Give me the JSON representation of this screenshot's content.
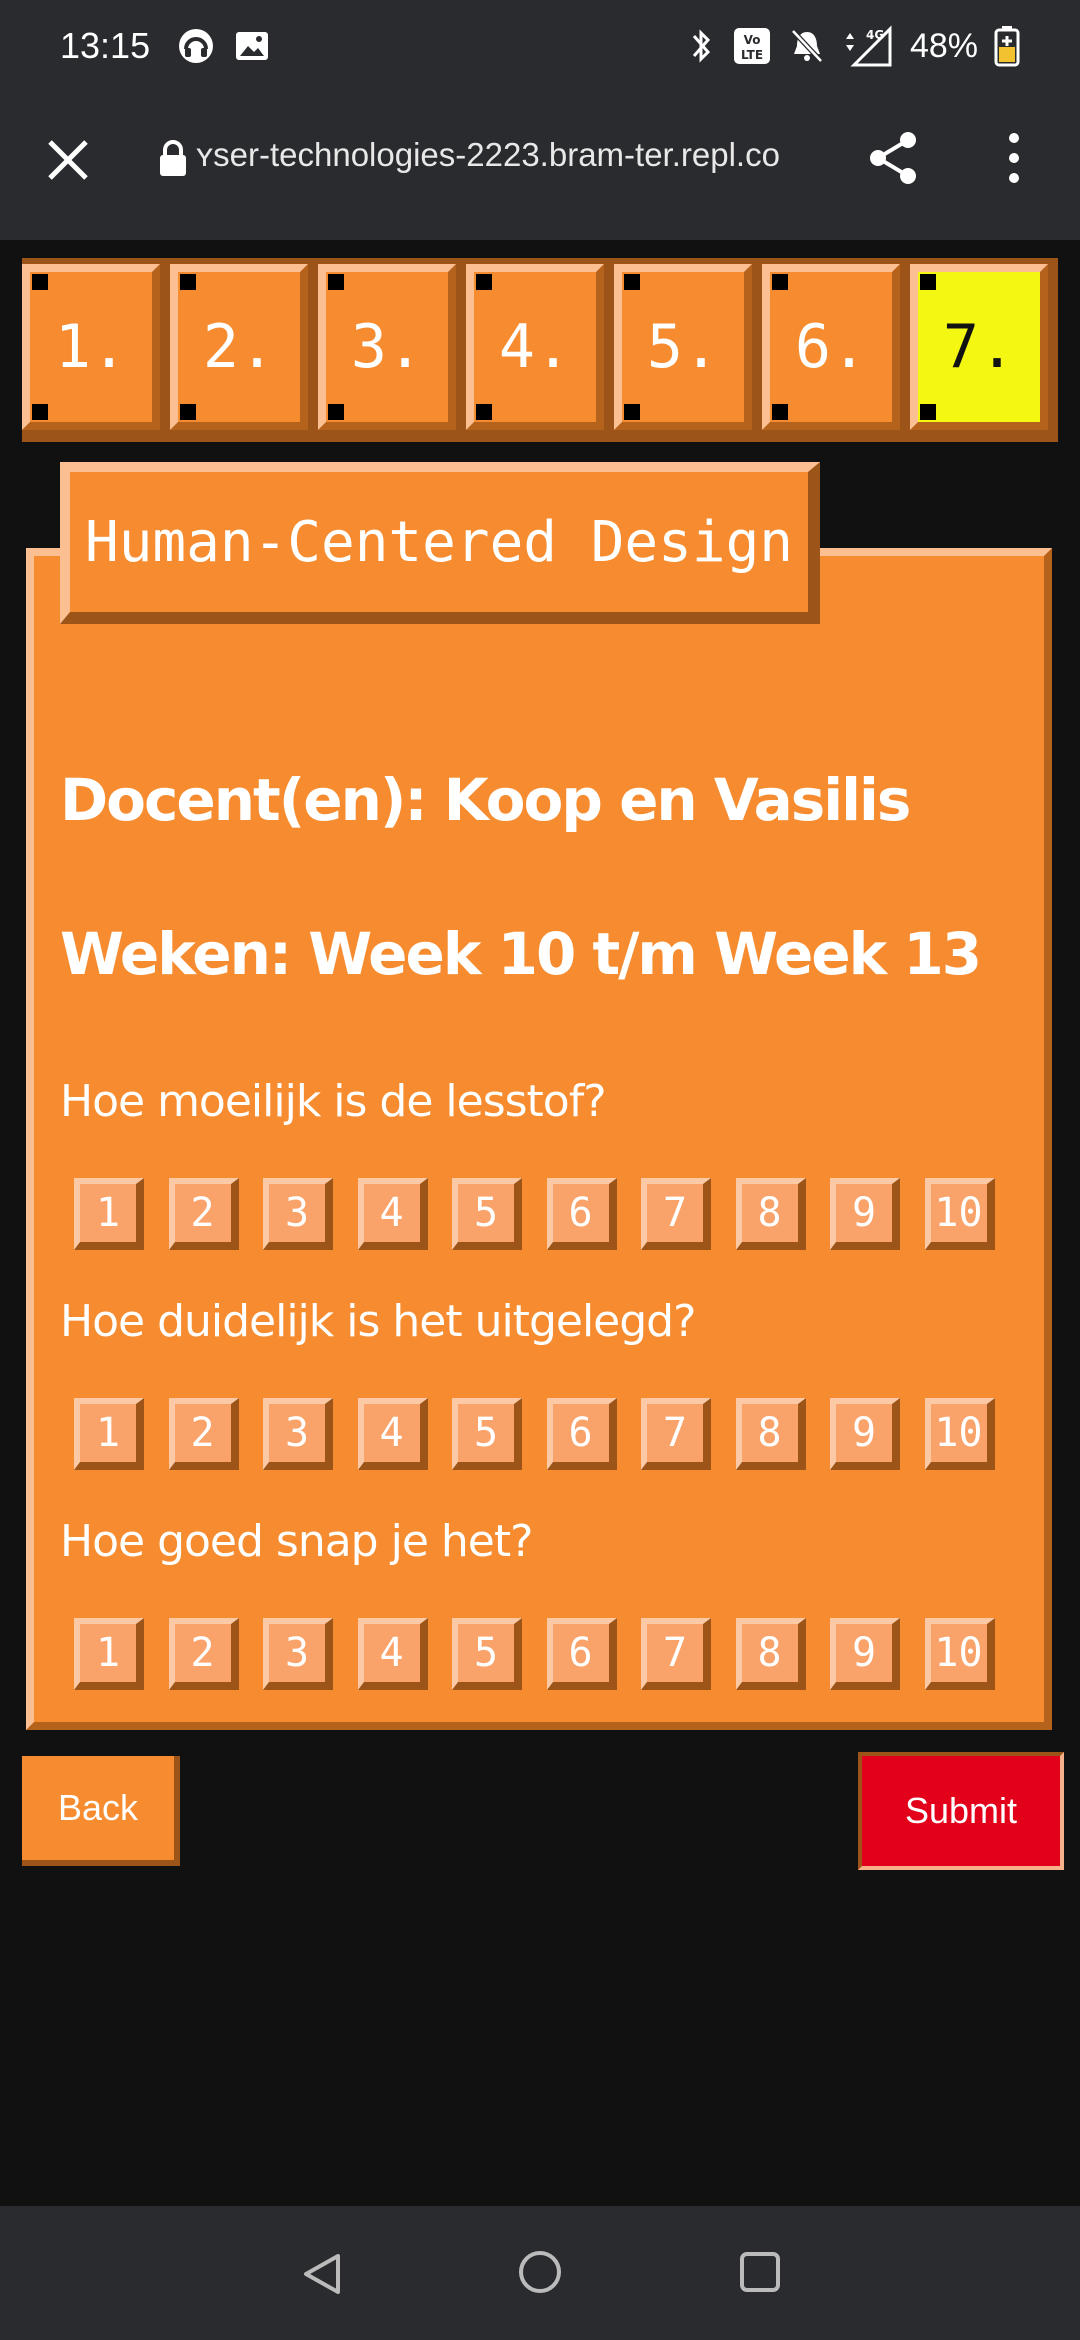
{
  "status_bar": {
    "time": "13:15",
    "battery": "48%",
    "network": "4G",
    "volte": "Vo LTE",
    "icons": [
      "headset-icon",
      "image-icon",
      "bluetooth-icon",
      "volte-icon",
      "mute-icon",
      "signal-icon",
      "battery-icon"
    ]
  },
  "browser": {
    "url": "ʏser-technologies-2223.bram-ter.repl.co"
  },
  "steps": [
    {
      "label": "1."
    },
    {
      "label": "2."
    },
    {
      "label": "3."
    },
    {
      "label": "4."
    },
    {
      "label": "5."
    },
    {
      "label": "6."
    },
    {
      "label": "7.",
      "active": true
    }
  ],
  "card": {
    "title": "Human-Centered Design",
    "teacher": "Docent(en): Koop en Vasilis",
    "weeks": "Weken: Week 10 t/m Week 13",
    "questions": [
      {
        "text": "Hoe moeilijk is de lesstof?"
      },
      {
        "text": "Hoe duidelijk is het uitgelegd?"
      },
      {
        "text": "Hoe goed snap je het?"
      }
    ],
    "scale": [
      "1",
      "2",
      "3",
      "4",
      "5",
      "6",
      "7",
      "8",
      "9",
      "10"
    ]
  },
  "buttons": {
    "back": "Back",
    "submit": "Submit"
  },
  "colors": {
    "orange": "#f68c2f",
    "highlight": "#f3f712",
    "submit": "#e3001a",
    "shadow": "#9c5418"
  }
}
